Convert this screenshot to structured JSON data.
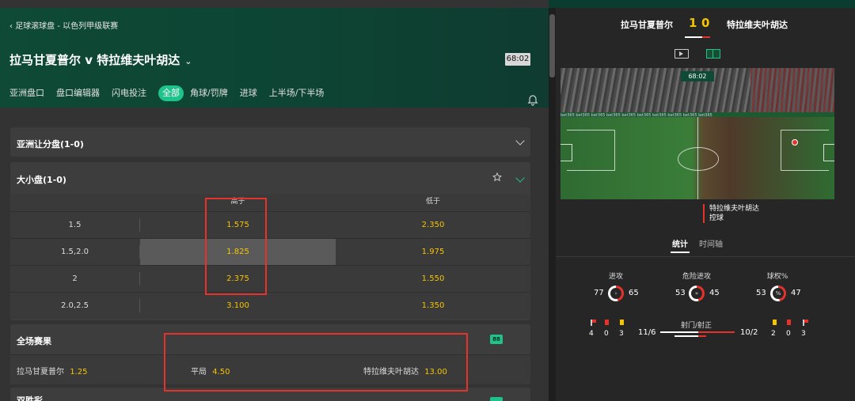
{
  "breadcrumb": "足球滚球盘 - 以色列甲级联赛",
  "match_title": "拉马甘夏普尔 v 特拉维夫叶胡达",
  "clock": "68:02",
  "tabs": [
    {
      "label": "亚洲盘口",
      "active": false
    },
    {
      "label": "盘口编辑器",
      "active": false
    },
    {
      "label": "闪电投注",
      "active": false
    },
    {
      "label": "全部",
      "active": true
    },
    {
      "label": "角球/罚牌",
      "active": false
    },
    {
      "label": "进球",
      "active": false
    },
    {
      "label": "上半场/下半场",
      "active": false
    }
  ],
  "markets": {
    "asian_handicap": {
      "title": "亚洲让分盘(1-0)"
    },
    "totals": {
      "title": "大小盘(1-0)",
      "col_over": "高于",
      "col_under": "低于",
      "rows": [
        {
          "line": "1.5",
          "over": "1.575",
          "under": "2.350"
        },
        {
          "line": "1.5,2.0",
          "over": "1.825",
          "under": "1.975"
        },
        {
          "line": "2",
          "over": "2.375",
          "under": "1.550"
        },
        {
          "line": "2.0,2.5",
          "over": "3.100",
          "under": "1.350"
        }
      ]
    },
    "full_time": {
      "title": "全场赛果",
      "badge": "88",
      "home": {
        "label": "拉马甘夏普尔",
        "odds": "1.25"
      },
      "draw": {
        "label": "平局",
        "odds": "4.50"
      },
      "away": {
        "label": "特拉维夫叶胡达",
        "odds": "13.00"
      }
    },
    "next": {
      "title": "双胜彩"
    }
  },
  "scoreboard": {
    "home": "拉马甘夏普尔",
    "home_score": "1",
    "away_score": "0",
    "away": "特拉维夫叶胡达"
  },
  "live_view": {
    "clock": "68:02",
    "event_team": "特拉维夫叶胡达",
    "event_action": "控球",
    "ad_text": "bet365  bet365  bet365  bet365  bet365  bet365  bet365  bet365  bet365  bet365"
  },
  "stats_tabs": {
    "stats": "统计",
    "timeline": "时间轴"
  },
  "stats": {
    "attacks": {
      "label": "进攻",
      "home": "77",
      "away": "65"
    },
    "dangerous": {
      "label": "危险进攻",
      "home": "53",
      "away": "45"
    },
    "possession": {
      "label": "球权%",
      "home": "53",
      "away": "47"
    },
    "shots_label": "射门/射正",
    "shots_home": "11/6",
    "shots_away": "10/2",
    "home_corners": "4",
    "home_red": "0",
    "home_yellow": "3",
    "away_yellow": "2",
    "away_red": "0",
    "away_corners": "3"
  },
  "colors": {
    "accent": "#1fc28b",
    "odds": "#f5c400",
    "highlight_box": "#e5322b"
  }
}
